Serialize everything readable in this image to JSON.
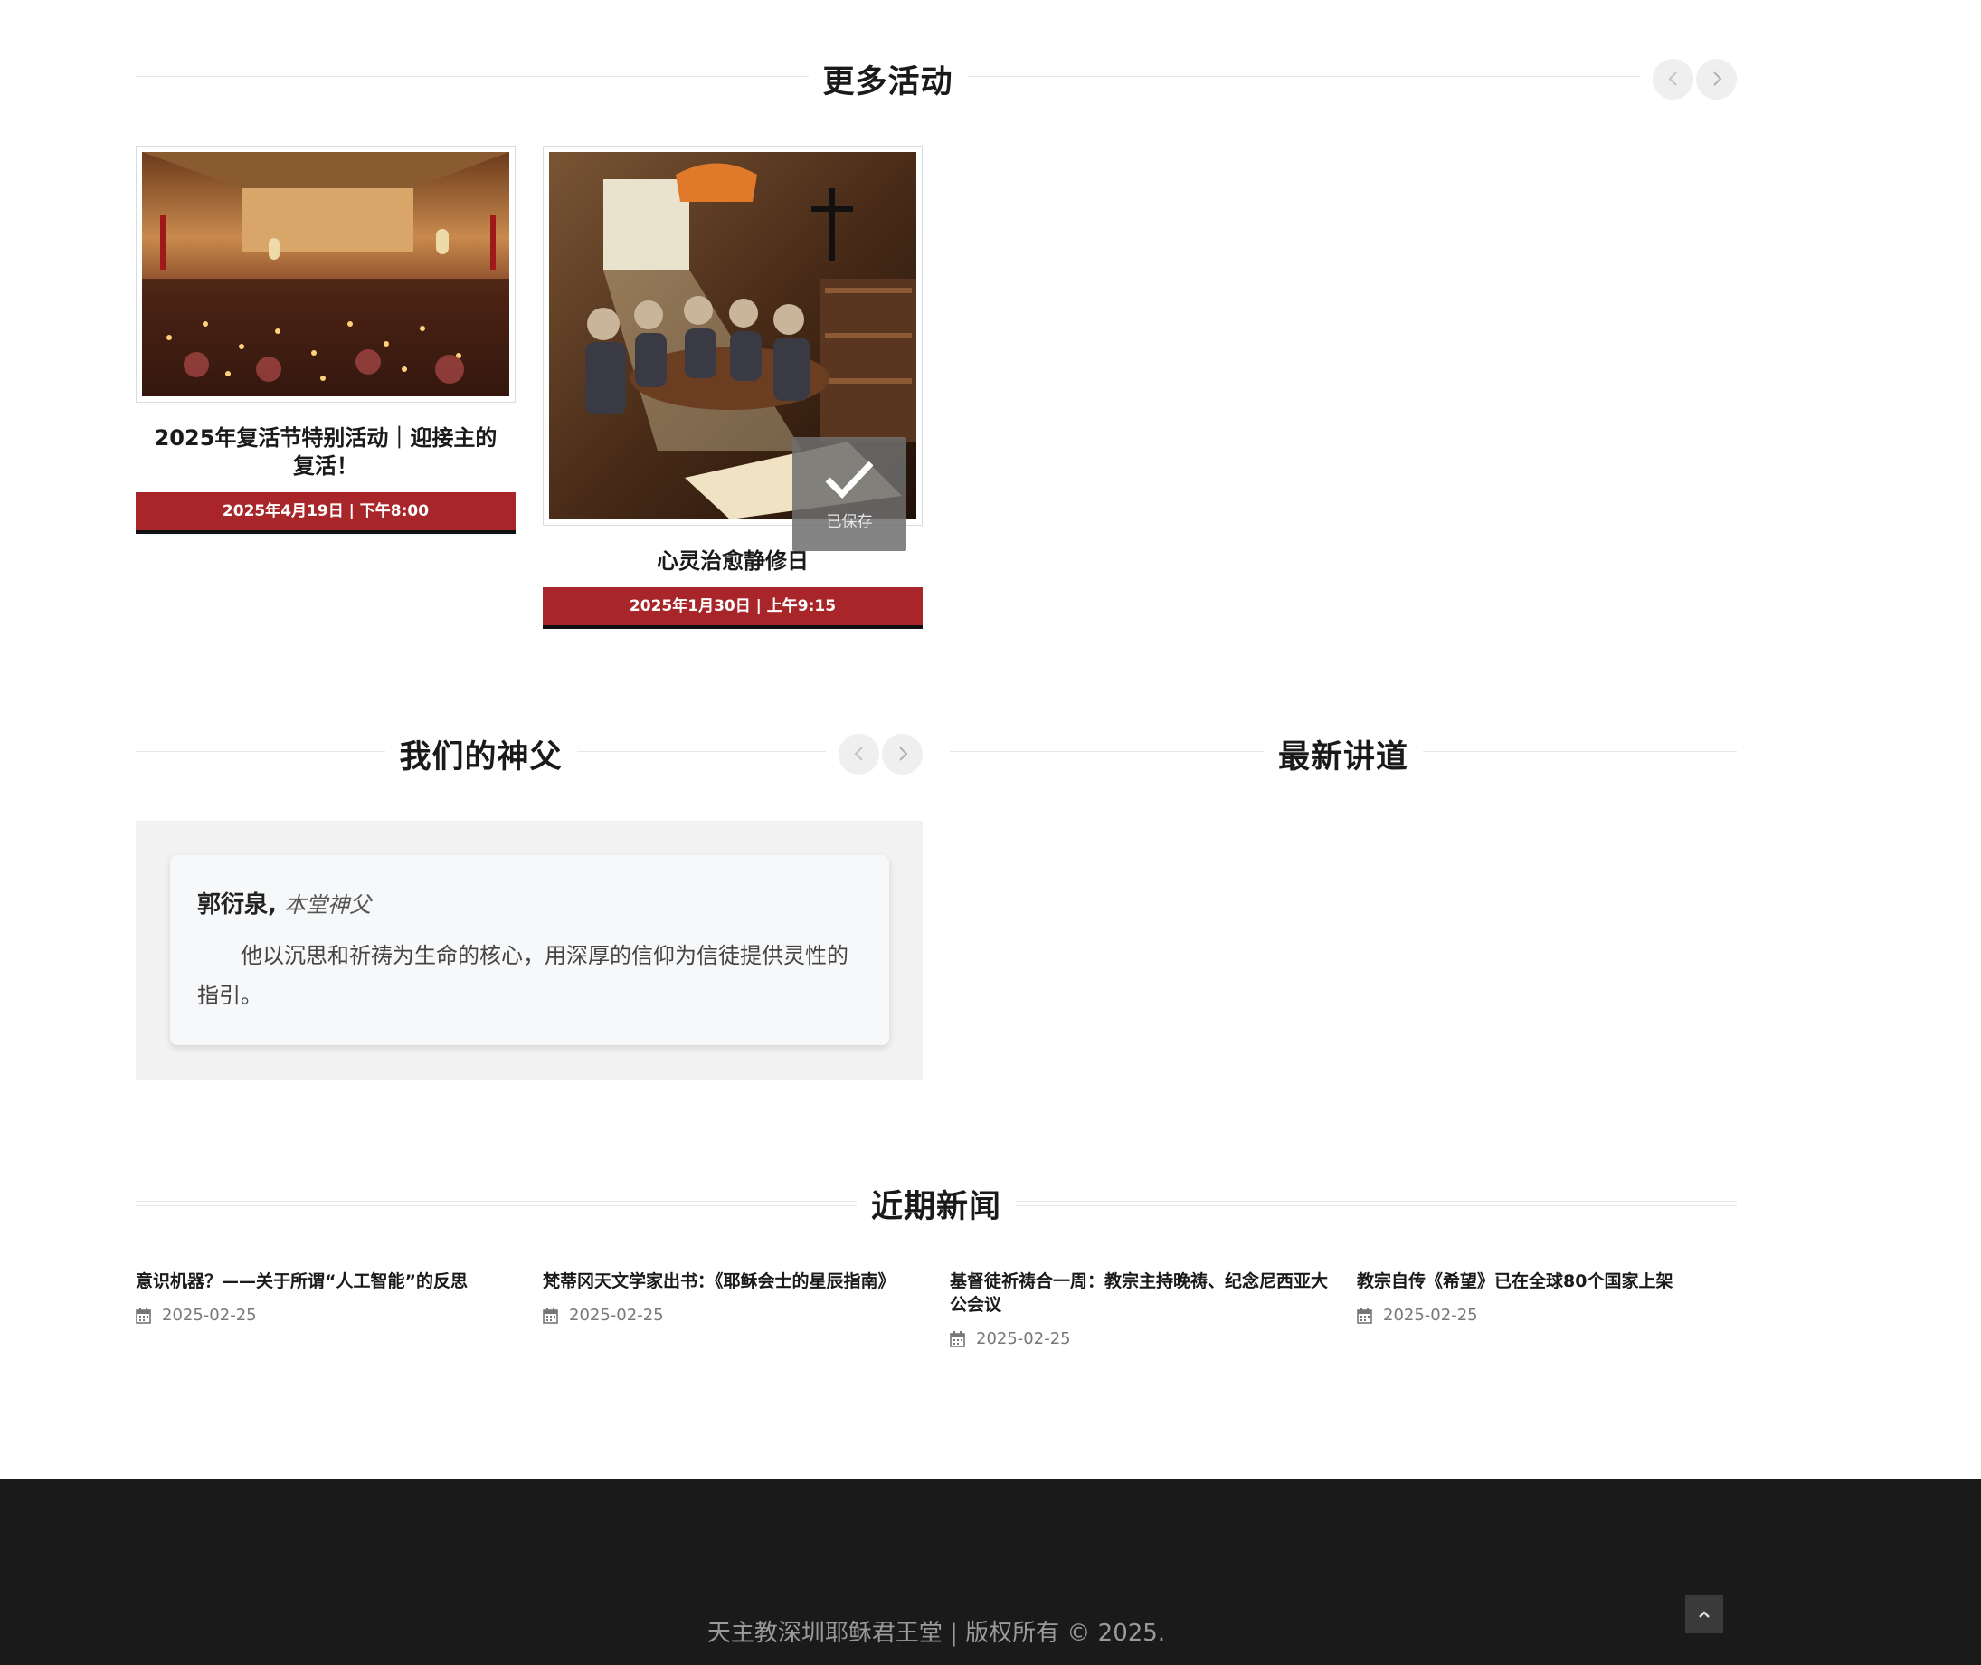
{
  "events": {
    "title": "更多活动",
    "items": [
      {
        "title": "2025年复活节特别活动｜迎接主的复活！",
        "date": "2025年4月19日 | 下午8:00"
      },
      {
        "title": "心灵治愈静修日",
        "date": "2025年1月30日 | 上午9:15"
      }
    ],
    "saved_label": "已保存"
  },
  "priests": {
    "title": "我们的神父",
    "name": "郭衍泉,",
    "role": "本堂神父",
    "description": "他以沉思和祈祷为生命的核心，用深厚的信仰为信徒提供灵性的指引。"
  },
  "sermons": {
    "title": "最新讲道"
  },
  "news": {
    "title": "近期新闻",
    "items": [
      {
        "title": "意识机器？——关于所谓“人工智能”的反思",
        "date": "2025-02-25"
      },
      {
        "title": "梵蒂冈天文学家出书：《耶稣会士的星辰指南》",
        "date": "2025-02-25"
      },
      {
        "title": "基督徒祈祷合一周：教宗主持晚祷、纪念尼西亚大公会议",
        "date": "2025-02-25"
      },
      {
        "title": "教宗自传《希望》已在全球80个国家上架",
        "date": "2025-02-25"
      }
    ]
  },
  "footer": {
    "copyright": "天主教深圳耶稣君王堂 | 版权所有 © 2025."
  },
  "colors": {
    "accent": "#a8262a",
    "footer_bg": "#1a1a1a"
  },
  "icons": [
    "chevron-left-icon",
    "chevron-right-icon",
    "checkmark-icon",
    "calendar-icon",
    "chevron-up-icon"
  ]
}
